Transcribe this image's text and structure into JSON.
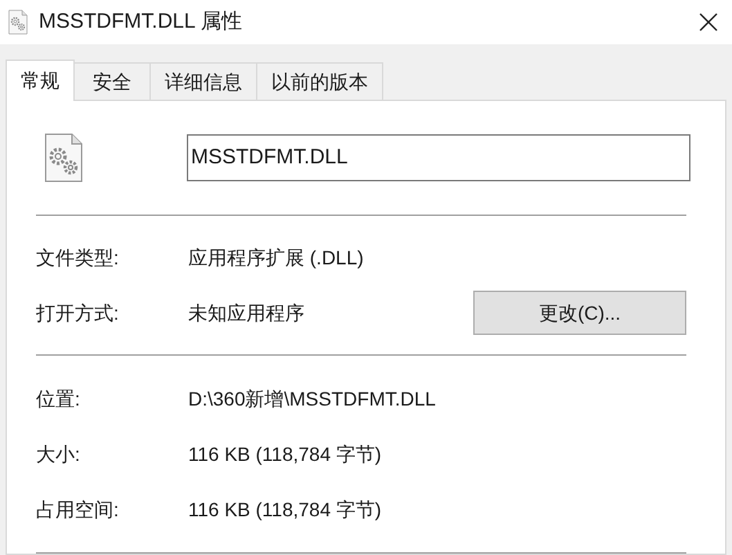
{
  "window": {
    "title": "MSSTDFMT.DLL 属性"
  },
  "tabs": [
    {
      "label": "常规",
      "selected": true
    },
    {
      "label": "安全",
      "selected": false
    },
    {
      "label": "详细信息",
      "selected": false
    },
    {
      "label": "以前的版本",
      "selected": false
    }
  ],
  "file_name": "MSSTDFMT.DLL",
  "group1": [
    {
      "label": "文件类型:",
      "value": "应用程序扩展 (.DLL)"
    },
    {
      "label": "打开方式:",
      "value": "未知应用程序",
      "button": "更改(C)..."
    }
  ],
  "group2": [
    {
      "label": "位置:",
      "value": "D:\\360新增\\MSSTDFMT.DLL"
    },
    {
      "label": "大小:",
      "value": "116 KB (118,784 字节)"
    },
    {
      "label": "占用空间:",
      "value": "116 KB (118,784 字节)"
    }
  ]
}
